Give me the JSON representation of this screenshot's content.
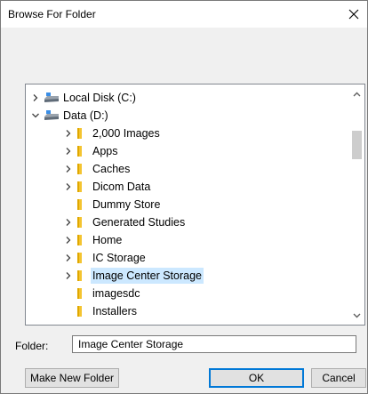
{
  "window": {
    "title": "Browse For Folder"
  },
  "tree": {
    "items": [
      {
        "label": "Local Disk (C:)",
        "icon": "drive-icon",
        "expander": "collapsed",
        "level": 0,
        "selected": false
      },
      {
        "label": "Data (D:)",
        "icon": "drive-icon",
        "expander": "expanded",
        "level": 0,
        "selected": false
      },
      {
        "label": "2,000 Images",
        "icon": "folder-icon",
        "expander": "collapsed",
        "level": 1,
        "selected": false
      },
      {
        "label": "Apps",
        "icon": "folder-icon",
        "expander": "collapsed",
        "level": 1,
        "selected": false
      },
      {
        "label": "Caches",
        "icon": "folder-icon",
        "expander": "collapsed",
        "level": 1,
        "selected": false
      },
      {
        "label": "Dicom Data",
        "icon": "folder-icon",
        "expander": "collapsed",
        "level": 1,
        "selected": false
      },
      {
        "label": "Dummy Store",
        "icon": "folder-icon",
        "expander": "none",
        "level": 1,
        "selected": false
      },
      {
        "label": "Generated Studies",
        "icon": "folder-icon",
        "expander": "collapsed",
        "level": 1,
        "selected": false
      },
      {
        "label": "Home",
        "icon": "folder-icon",
        "expander": "collapsed",
        "level": 1,
        "selected": false
      },
      {
        "label": "IC Storage",
        "icon": "folder-icon",
        "expander": "collapsed",
        "level": 1,
        "selected": false
      },
      {
        "label": "Image Center Storage",
        "icon": "folder-icon",
        "expander": "collapsed",
        "level": 1,
        "selected": true
      },
      {
        "label": "imagesdc",
        "icon": "folder-icon",
        "expander": "none",
        "level": 1,
        "selected": false
      },
      {
        "label": "Installers",
        "icon": "folder-icon",
        "expander": "none",
        "level": 1,
        "selected": false
      }
    ]
  },
  "folder": {
    "label": "Folder:",
    "value": "Image Center Storage"
  },
  "buttons": {
    "make_new_folder": "Make New Folder",
    "ok": "OK",
    "cancel": "Cancel"
  },
  "colors": {
    "selection": "#cce8ff",
    "folder": "#f4c430",
    "accent": "#0078d7"
  }
}
